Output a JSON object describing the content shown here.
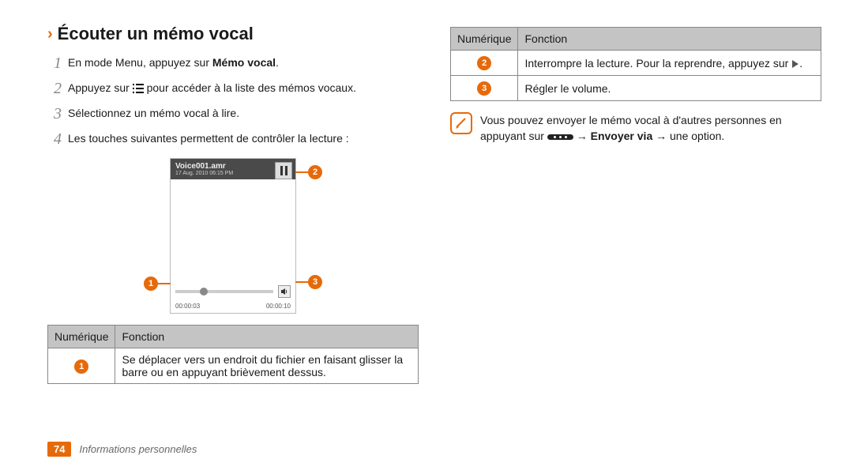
{
  "heading": "Écouter un mémo vocal",
  "steps": {
    "s1_pre": "En mode Menu, appuyez sur ",
    "s1_bold": "Mémo vocal",
    "s1_post": ".",
    "s2_pre": "Appuyez sur ",
    "s2_post": " pour accéder à la liste des mémos vocaux.",
    "s3": "Sélectionnez un mémo vocal à lire.",
    "s4": "Les touches suivantes permettent de contrôler la lecture :"
  },
  "phone": {
    "title": "Voice001.amr",
    "date": "17 Aug. 2010 06:15 PM",
    "time_elapsed": "00:00:03",
    "time_total": "00:00:10"
  },
  "table_header": {
    "col1": "Numérique",
    "col2": "Fonction"
  },
  "table_left": {
    "r1_text": "Se déplacer vers un endroit du fichier en faisant glisser la barre ou en appuyant brièvement dessus."
  },
  "table_right": {
    "r2_text_pre": "Interrompre la lecture. Pour la reprendre, appuyez sur ",
    "r2_text_post": ".",
    "r3_text": "Régler le volume."
  },
  "note": {
    "pre": "Vous pouvez envoyer le mémo vocal à d'autres personnes en appuyant sur ",
    "arrow1": " → ",
    "bold": "Envoyer via",
    "arrow2": " → une option."
  },
  "footer": {
    "page": "74",
    "section": "Informations personnelles"
  },
  "labels": {
    "n1": "1",
    "n2": "2",
    "n3": "3",
    "n4": "4",
    "c1": "1",
    "c2": "2",
    "c3": "3"
  }
}
